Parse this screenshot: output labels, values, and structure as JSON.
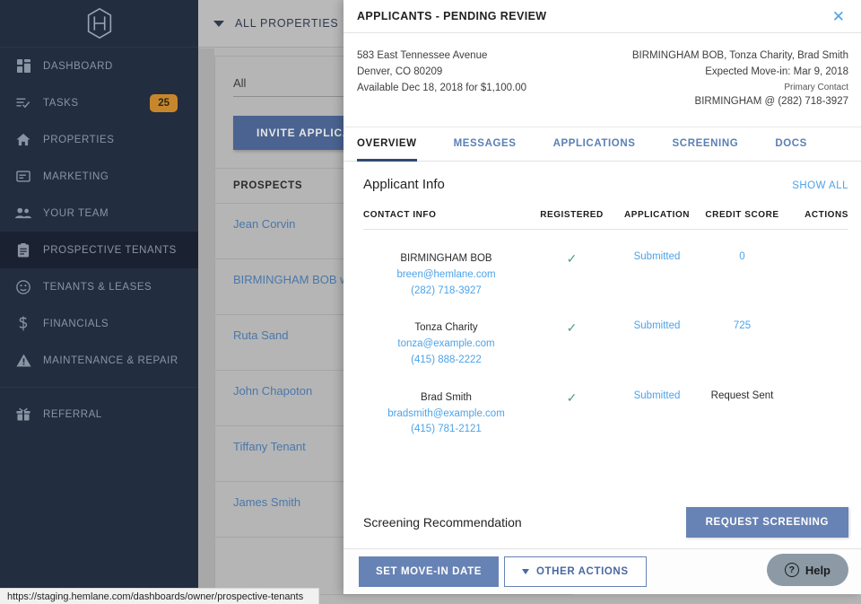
{
  "sidebar": {
    "logo_icon": "hexagon-h-logo",
    "items": [
      {
        "label": "DASHBOARD",
        "icon": "dashboard-icon",
        "active": false,
        "badge": null
      },
      {
        "label": "TASKS",
        "icon": "tasks-icon",
        "active": false,
        "badge": "25"
      },
      {
        "label": "PROPERTIES",
        "icon": "home-icon",
        "active": false,
        "badge": null
      },
      {
        "label": "MARKETING",
        "icon": "megaphone-icon",
        "active": false,
        "badge": null
      },
      {
        "label": "YOUR TEAM",
        "icon": "people-icon",
        "active": false,
        "badge": null
      },
      {
        "label": "PROSPECTIVE TENANTS",
        "icon": "clipboard-icon",
        "active": true,
        "badge": null
      },
      {
        "label": "TENANTS & LEASES",
        "icon": "face-icon",
        "active": false,
        "badge": null
      },
      {
        "label": "FINANCIALS",
        "icon": "dollar-icon",
        "active": false,
        "badge": null
      },
      {
        "label": "MAINTENANCE & REPAIR",
        "icon": "warning-icon",
        "active": false,
        "badge": null
      },
      {
        "label": "REFERRAL",
        "icon": "gift-icon",
        "active": false,
        "badge": null
      }
    ],
    "badge_color": "#c8862c",
    "background_color": "#222d40"
  },
  "background_page": {
    "topbar": {
      "label": "ALL PROPERTIES",
      "caret_icon": "caret-down-icon"
    },
    "filter": {
      "value": "All",
      "caret_icon": "caret-down-icon"
    },
    "invite_button": "INVITE APPLICANT",
    "prospects_header": "PROSPECTS",
    "prospects": [
      "Jean Corvin",
      "BIRMINGHAM BOB with Tonza Charity, Brad Smith",
      "Ruta Sand",
      "John Chapoton",
      "Tiffany Tenant",
      "James Smith"
    ]
  },
  "modal": {
    "title": "APPLICANTS - PENDING REVIEW",
    "close_icon": "close-icon",
    "summary": {
      "address_line1": "583 East Tennessee Avenue",
      "address_line2": "Denver, CO 80209",
      "availability": "Available Dec 18, 2018 for $1,100.00",
      "applicants": "BIRMINGHAM BOB, Tonza Charity, Brad Smith",
      "expected_movein": "Expected Move-in: Mar 9, 2018",
      "primary_contact_label": "Primary Contact",
      "primary_contact": "BIRMINGHAM @ (282) 718-3927"
    },
    "tabs": [
      {
        "label": "OVERVIEW",
        "active": true
      },
      {
        "label": "MESSAGES",
        "active": false
      },
      {
        "label": "APPLICATIONS",
        "active": false
      },
      {
        "label": "SCREENING",
        "active": false
      },
      {
        "label": "DOCS",
        "active": false
      }
    ],
    "applicant_info": {
      "section_title": "Applicant Info",
      "show_all": "SHOW ALL",
      "columns": [
        "CONTACT INFO",
        "REGISTERED",
        "APPLICATION",
        "CREDIT SCORE",
        "ACTIONS"
      ],
      "rows": [
        {
          "name": "BIRMINGHAM BOB",
          "email": "breen@hemlane.com",
          "phone": "(282) 718-3927",
          "registered": "✓",
          "application": "Submitted",
          "credit_score": "0",
          "credit_is_link": true,
          "actions": ""
        },
        {
          "name": "Tonza Charity",
          "email": "tonza@example.com",
          "phone": "(415) 888-2222",
          "registered": "✓",
          "application": "Submitted",
          "credit_score": "725",
          "credit_is_link": true,
          "actions": ""
        },
        {
          "name": "Brad Smith",
          "email": "bradsmith@example.com",
          "phone": "(415) 781-2121",
          "registered": "✓",
          "application": "Submitted",
          "credit_score": "Request Sent",
          "credit_is_link": false,
          "actions": ""
        }
      ]
    },
    "screening": {
      "label": "Screening Recommendation",
      "button": "REQUEST SCREENING"
    },
    "footer": {
      "set_movein": "SET MOVE-IN DATE",
      "other_actions": "OTHER ACTIONS",
      "other_actions_caret": "caret-down-icon",
      "help": "Help",
      "help_icon": "question-circle-icon"
    }
  },
  "statusbar": {
    "url": "https://staging.hemlane.com/dashboards/owner/prospective-tenants"
  },
  "colors": {
    "sidebar_bg": "#222d40",
    "accent_blue": "#4da3e8",
    "button_blue": "#6782b4",
    "tab_blue": "#5b7fb5",
    "check_green": "#4f9e8d",
    "badge_orange": "#c8862c"
  }
}
